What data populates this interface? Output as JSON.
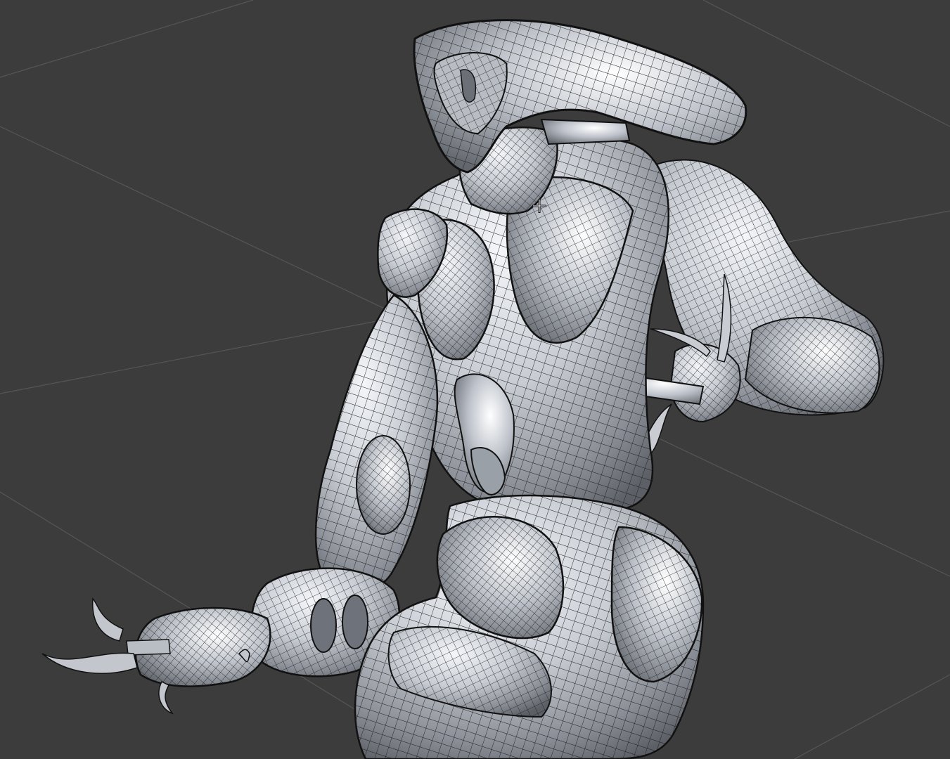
{
  "viewport": {
    "mode": "3d-sculpt-viewport",
    "shading": "matcap-wireframe-overlay",
    "background_color": "#3c3c3c",
    "grid_color": "#555555",
    "mesh_color": "#d9dde3",
    "wire_color": "#1a1a1a"
  },
  "model": {
    "subject": "armored-robotic-creature",
    "parts": [
      "head-crest",
      "neck",
      "chest-armor",
      "left-arm-claw",
      "right-arm-claw",
      "abdomen",
      "hip-armor",
      "thigh"
    ]
  },
  "cursor": {
    "icon": "crosshair-icon"
  }
}
